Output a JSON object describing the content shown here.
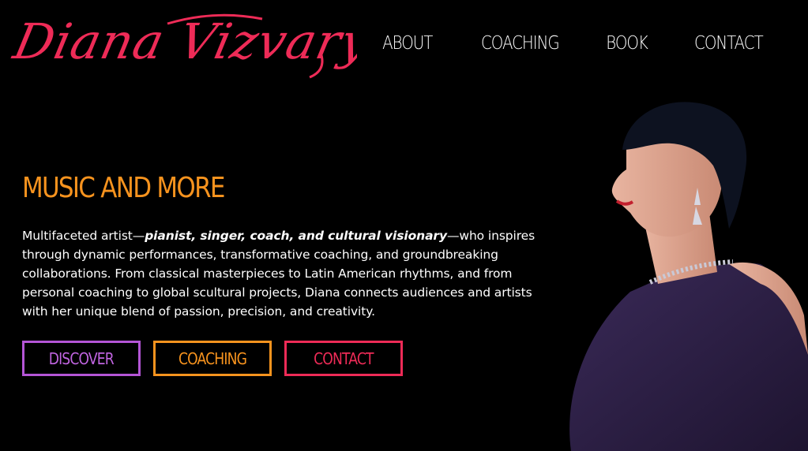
{
  "header": {
    "logo_text": "Diana Vizvary",
    "nav": [
      {
        "label": "ABOUT"
      },
      {
        "label": "COACHING"
      },
      {
        "label": "BOOK"
      },
      {
        "label": "CONTACT"
      }
    ]
  },
  "hero": {
    "title": "MUSIC AND MORE",
    "intro_prefix": "Multifaceted artist—",
    "intro_emphasis": "pianist, singer, coach, and cultural visionary",
    "intro_rest": "—who inspires through dynamic performances, transformative coaching, and groundbreaking collaborations. From classical masterpieces to Latin American rhythms, and from personal coaching to global scultural projects, Diana connects audiences and artists with her unique blend of passion, precision, and creativity.",
    "buttons": [
      {
        "label": "DISCOVER",
        "color": "#b455d6"
      },
      {
        "label": "COACHING",
        "color": "#f7931e"
      },
      {
        "label": "CONTACT",
        "color": "#ee2b57"
      }
    ]
  },
  "colors": {
    "background": "#000000",
    "logo": "#ee2b57",
    "title": "#f7931e"
  }
}
